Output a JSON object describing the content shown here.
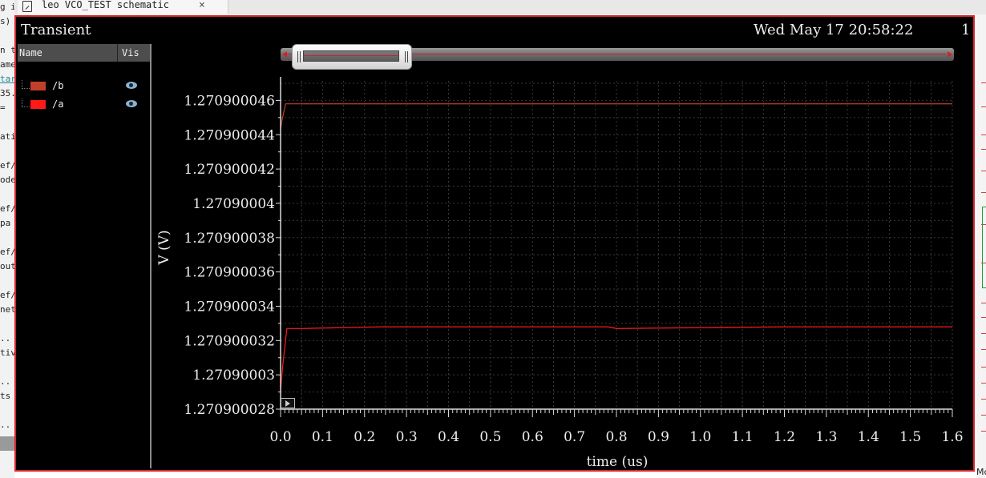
{
  "left_strip_lines": [
    "g i",
    "s)",
    "",
    "n t",
    "ame",
    "tar",
    "35.",
    "=",
    "",
    "ati",
    "",
    "ef/",
    "ode",
    "",
    "ef/",
    "pa",
    "",
    "ef/",
    "out",
    "",
    "ef/",
    "net",
    "",
    "..",
    "tiv",
    "",
    "..",
    "ts",
    "",
    ".."
  ],
  "tab": {
    "title": "leo VCO_TEST schematic",
    "close": "×"
  },
  "header": {
    "title": "Transient",
    "datetime": "Wed May 17 20:58:22",
    "number": "1"
  },
  "legend": {
    "col_name": "Name",
    "col_vis": "Vis",
    "signals": [
      {
        "name": "/b",
        "color": "#c0402a"
      },
      {
        "name": "/a",
        "color": "#ff1a1a"
      }
    ]
  },
  "right_strip_text": "Mc",
  "chart_data": {
    "type": "line",
    "xlabel": "time (us)",
    "ylabel": "V (V)",
    "xlim": [
      0.0,
      1.6
    ],
    "ylim": [
      1.270900028,
      1.270900047
    ],
    "xticks": [
      "0.0",
      "0.1",
      "0.2",
      "0.3",
      "0.4",
      "0.5",
      "0.6",
      "0.7",
      "0.8",
      "0.9",
      "1.0",
      "1.1",
      "1.2",
      "1.3",
      "1.4",
      "1.5",
      "1.6"
    ],
    "yticks": [
      {
        "label": "1.270900046",
        "value": 1.270900046
      },
      {
        "label": "1.270900044",
        "value": 1.270900044
      },
      {
        "label": "1.270900042",
        "value": 1.270900042
      },
      {
        "label": "1.27090004",
        "value": 1.27090004
      },
      {
        "label": "1.270900038",
        "value": 1.270900038
      },
      {
        "label": "1.270900036",
        "value": 1.270900036
      },
      {
        "label": "1.270900034",
        "value": 1.270900034
      },
      {
        "label": "1.270900032",
        "value": 1.270900032
      },
      {
        "label": "1.27090003",
        "value": 1.27090003
      },
      {
        "label": "1.270900028",
        "value": 1.270900028
      }
    ],
    "grid": true,
    "series": [
      {
        "name": "/b",
        "color": "#c0402a",
        "x": [
          0.0,
          0.003,
          0.012,
          0.05,
          0.3,
          0.6,
          0.9,
          1.2,
          1.6
        ],
        "y": [
          1.2709000443,
          1.2709000448,
          1.2709000458,
          1.2709000458,
          1.2709000458,
          1.2709000458,
          1.2709000458,
          1.2709000458,
          1.2709000458
        ]
      },
      {
        "name": "/a",
        "color": "#ff1a1a",
        "x": [
          0.0,
          0.005,
          0.015,
          0.05,
          0.24,
          0.3,
          0.6,
          0.78,
          0.8,
          1.2,
          1.6
        ],
        "y": [
          1.270900029,
          1.2709000305,
          1.2709000327,
          1.2709000327,
          1.2709000328,
          1.2709000328,
          1.2709000328,
          1.2709000328,
          1.2709000327,
          1.2709000328,
          1.2709000328
        ]
      }
    ]
  }
}
